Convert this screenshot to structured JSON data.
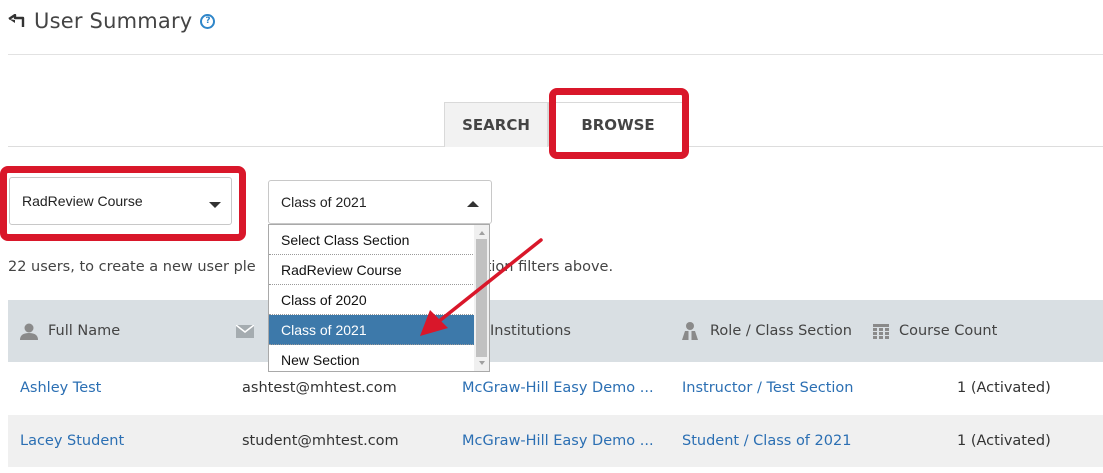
{
  "header": {
    "back_icon": "back-arrow-icon",
    "title": "User Summary",
    "help_icon": "help-icon",
    "help_glyph": "?"
  },
  "tabs": [
    {
      "label": "SEARCH",
      "active": false
    },
    {
      "label": "BROWSE",
      "active": true
    }
  ],
  "filters": {
    "course_select": {
      "value": "RadReview Course"
    },
    "section_select": {
      "value": "Class of 2021",
      "open": true,
      "options": [
        "Select Class Section",
        "RadReview Course",
        "Class of 2020",
        "Class of 2021",
        "New Section"
      ],
      "selected_index": 3
    }
  },
  "users_info": {
    "visible_left": "22 users, to create a new user ple",
    "visible_right": "ction filters above."
  },
  "table": {
    "columns": [
      {
        "label": "Full Name",
        "icon": "user-icon"
      },
      {
        "label": "",
        "icon": "email-icon"
      },
      {
        "label": "Institutions",
        "icon": ""
      },
      {
        "label": "Role / Class Section",
        "icon": "role-icon"
      },
      {
        "label": "Course Count",
        "icon": "table-icon"
      }
    ],
    "rows": [
      {
        "full_name": "Ashley Test",
        "email": "ashtest@mhtest.com",
        "institution": "McGraw-Hill Easy Demo ...",
        "role_section": "Instructor / Test Section",
        "course_count": "1 (Activated)"
      },
      {
        "full_name": "Lacey Student",
        "email": "student@mhtest.com",
        "institution": "McGraw-Hill Easy Demo ...",
        "role_section": "Student / Class of 2021",
        "course_count": "1 (Activated)"
      }
    ]
  },
  "colors": {
    "highlight": "#d9172a",
    "link": "#2b6fb3",
    "selected_option": "#3d79aa",
    "table_header": "#d9dfe3"
  }
}
